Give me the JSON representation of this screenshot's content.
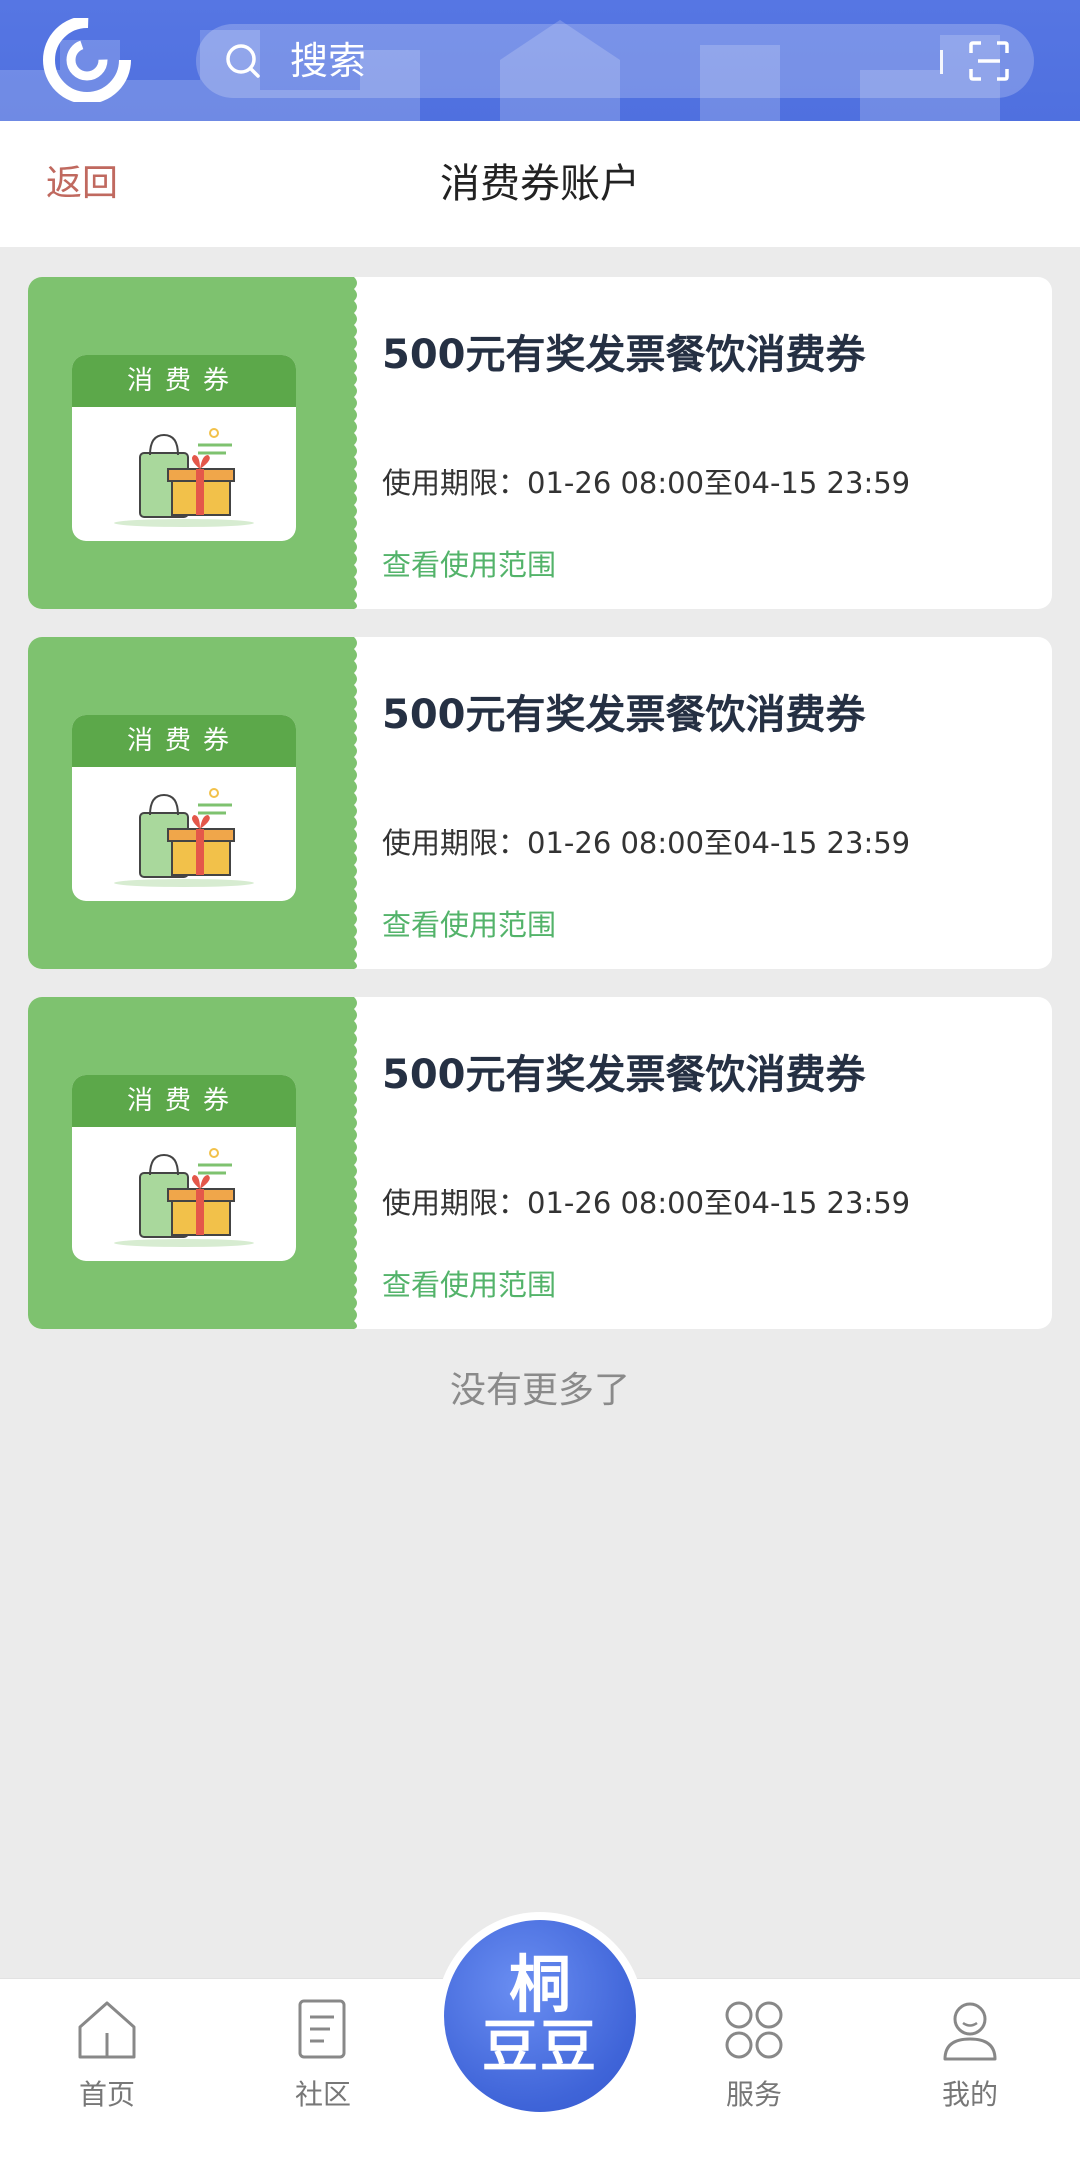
{
  "search": {
    "placeholder": "搜索"
  },
  "header": {
    "back_label": "返回",
    "title": "消费券账户"
  },
  "coupons": [
    {
      "card_label": "消费券",
      "name": "500元有奖发票餐饮消费券",
      "validity": "使用期限：01-26 08:00至04-15 23:59",
      "scope_link": "查看使用范围"
    },
    {
      "card_label": "消费券",
      "name": "500元有奖发票餐饮消费券",
      "validity": "使用期限：01-26 08:00至04-15 23:59",
      "scope_link": "查看使用范围"
    },
    {
      "card_label": "消费券",
      "name": "500元有奖发票餐饮消费券",
      "validity": "使用期限：01-26 08:00至04-15 23:59",
      "scope_link": "查看使用范围"
    }
  ],
  "list_end_text": "没有更多了",
  "nav": {
    "items": [
      {
        "label": "首页",
        "icon": "home-icon"
      },
      {
        "label": "社区",
        "icon": "document-icon"
      },
      {
        "label": "服务",
        "icon": "grid-icon"
      },
      {
        "label": "我的",
        "icon": "user-icon"
      }
    ],
    "center": {
      "line1": "桐",
      "line2": "豆豆"
    }
  },
  "colors": {
    "topbar": "#5676e3",
    "back_link": "#c0695f",
    "coupon_green": "#7ec26f",
    "link_green": "#53b36a",
    "center_button": "#3f64d8"
  }
}
